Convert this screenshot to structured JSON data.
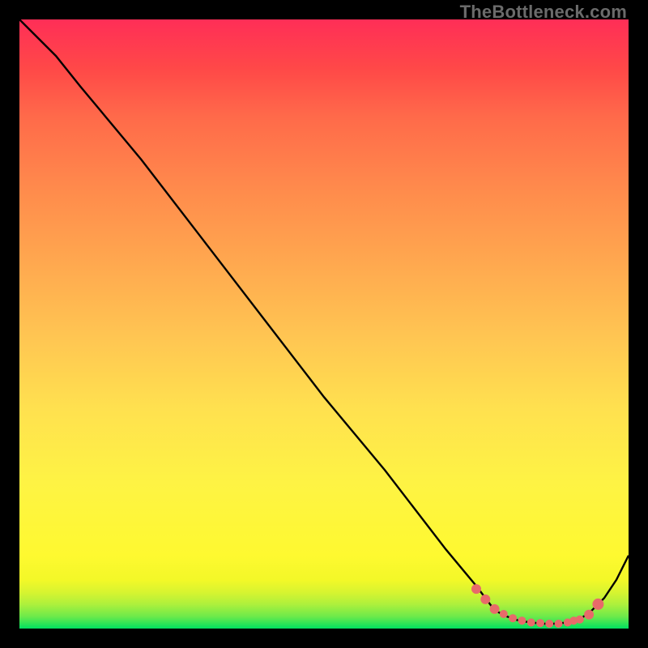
{
  "attribution": "TheBottleneck.com",
  "colors": {
    "curve": "#000000",
    "marker": "#e86a6a"
  },
  "chart_data": {
    "type": "line",
    "title": "",
    "xlabel": "",
    "ylabel": "",
    "xlim": [
      0,
      100
    ],
    "ylim": [
      0,
      100
    ],
    "grid": false,
    "series": [
      {
        "name": "bottleneck_curve",
        "x": [
          0,
          6,
          10,
          20,
          30,
          40,
          50,
          60,
          70,
          75,
          78,
          80,
          82,
          84,
          86,
          88,
          90,
          92,
          94,
          96,
          98,
          100
        ],
        "y": [
          100,
          94,
          89,
          77,
          64,
          51,
          38,
          26,
          13,
          7,
          3,
          2,
          1.3,
          1,
          0.8,
          0.8,
          1,
          1.5,
          3,
          5,
          8,
          12
        ]
      }
    ],
    "markers": {
      "series": "bottleneck_curve",
      "x": [
        75,
        76.5,
        78,
        79.5,
        81,
        82.5,
        84,
        85.5,
        87,
        88.5,
        90,
        91,
        92,
        93.5,
        95
      ],
      "y": [
        6.5,
        4.8,
        3.2,
        2.4,
        1.7,
        1.3,
        1.0,
        0.9,
        0.8,
        0.8,
        1.0,
        1.3,
        1.5,
        2.3,
        4.0
      ],
      "size": [
        6,
        6,
        6,
        5,
        5,
        5,
        5,
        5,
        5,
        5,
        5,
        5,
        5,
        6,
        7
      ]
    }
  }
}
